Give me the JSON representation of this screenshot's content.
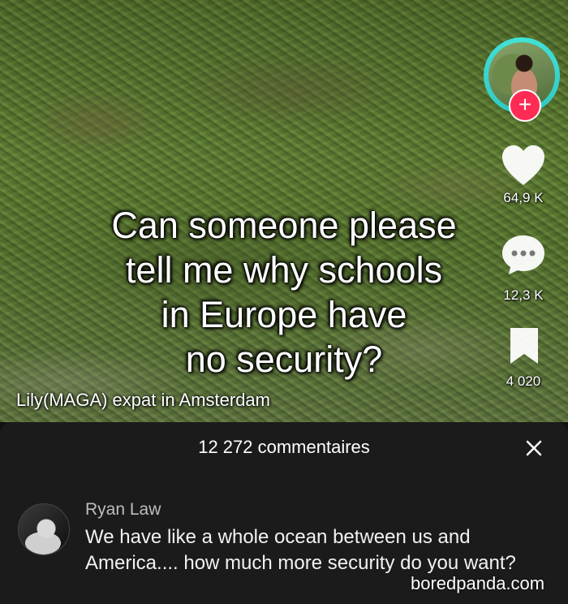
{
  "video": {
    "caption_lines": [
      "Can someone please",
      "tell me why schools",
      "in Europe have",
      "no security?"
    ],
    "author_text": "Lily(MAGA) expat in Amsterdam"
  },
  "sidebar": {
    "like_count": "64,9 K",
    "comment_count": "12,3 K",
    "save_count": "4 020",
    "follow_symbol": "+",
    "like_icon": "heart-icon",
    "comment_icon": "comment-bubble-icon",
    "save_icon": "bookmark-icon"
  },
  "comments_panel": {
    "title": "12 272 commentaires",
    "close_symbol": "×",
    "comments": [
      {
        "username": "Ryan Law",
        "text": "We have like a whole ocean between us and America.... how much more security do you want?"
      }
    ]
  },
  "watermark": "boredpanda.com",
  "colors": {
    "accent_red": "#fe2c55",
    "avatar_ring": "#43e3d8",
    "sheet_bg": "#1b1b1b"
  }
}
